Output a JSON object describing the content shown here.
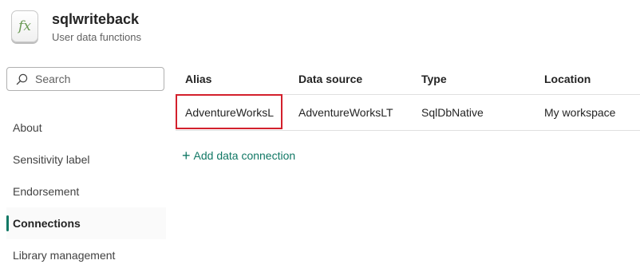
{
  "app": {
    "icon_glyph": "fx",
    "title": "sqlwriteback",
    "subtitle": "User data functions"
  },
  "search": {
    "placeholder": "Search"
  },
  "nav": {
    "items": [
      {
        "label": "About"
      },
      {
        "label": "Sensitivity label"
      },
      {
        "label": "Endorsement"
      },
      {
        "label": "Connections",
        "active": true
      },
      {
        "label": "Library management"
      }
    ]
  },
  "table": {
    "headers": [
      "Alias",
      "Data source",
      "Type",
      "Location"
    ],
    "rows": [
      [
        "AdventureWorksL",
        "AdventureWorksLT",
        "SqlDbNative",
        "My workspace"
      ]
    ]
  },
  "actions": {
    "add_connection": "Add data connection",
    "add_icon": "+"
  },
  "colors": {
    "accent": "#117865",
    "highlight": "#d3202c"
  }
}
